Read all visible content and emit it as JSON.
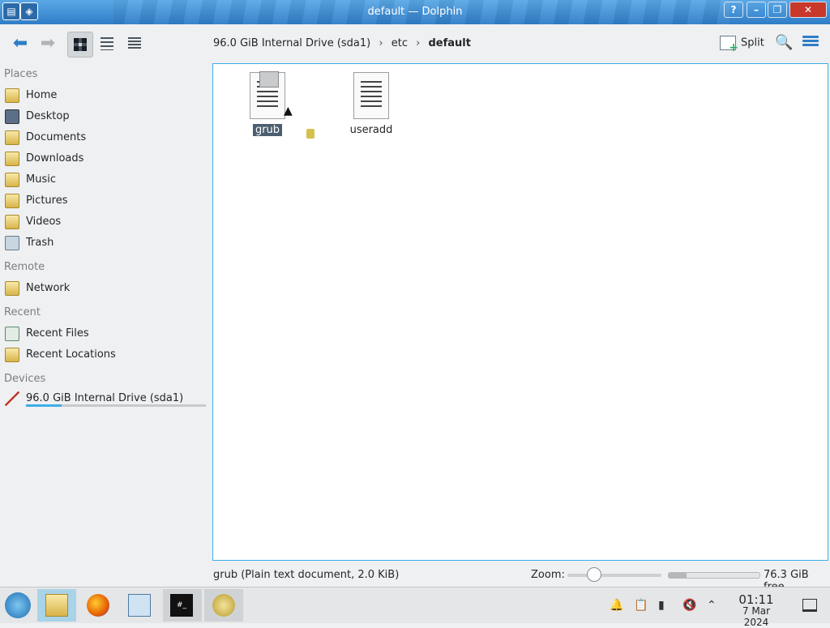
{
  "window": {
    "title": "default — Dolphin"
  },
  "toolbar": {
    "breadcrumb": [
      "96.0 GiB Internal Drive (sda1)",
      "etc",
      "default"
    ],
    "split_label": "Split"
  },
  "sidebar": {
    "sections": [
      {
        "title": "Places",
        "items": [
          {
            "label": "Home",
            "icon": "home-folder-icon"
          },
          {
            "label": "Desktop",
            "icon": "desktop-icon"
          },
          {
            "label": "Documents",
            "icon": "documents-folder-icon"
          },
          {
            "label": "Downloads",
            "icon": "downloads-folder-icon"
          },
          {
            "label": "Music",
            "icon": "music-folder-icon"
          },
          {
            "label": "Pictures",
            "icon": "pictures-folder-icon"
          },
          {
            "label": "Videos",
            "icon": "videos-folder-icon"
          },
          {
            "label": "Trash",
            "icon": "trash-icon"
          }
        ]
      },
      {
        "title": "Remote",
        "items": [
          {
            "label": "Network",
            "icon": "network-folder-icon"
          }
        ]
      },
      {
        "title": "Recent",
        "items": [
          {
            "label": "Recent Files",
            "icon": "recent-files-icon"
          },
          {
            "label": "Recent Locations",
            "icon": "recent-locations-icon"
          }
        ]
      },
      {
        "title": "Devices",
        "items": [
          {
            "label": "96.0 GiB Internal Drive (sda1)",
            "icon": "drive-icon"
          }
        ]
      }
    ],
    "drive_usage_fraction": 0.2
  },
  "files": [
    {
      "name": "grub",
      "selected": true,
      "icon": "text-document-icon"
    },
    {
      "name": "useradd",
      "selected": false,
      "icon": "text-document-icon"
    }
  ],
  "statusbar": {
    "selection": "grub (Plain text document, 2.0 KiB)",
    "zoom_label": "Zoom:",
    "free_space": "76.3 GiB free"
  },
  "taskbar": {
    "time": "01:11",
    "date": "7 Mar 2024",
    "apps": [
      "start-menu-icon",
      "file-manager-icon",
      "firefox-icon",
      "system-settings-icon",
      "terminal-icon",
      "archive-icon"
    ]
  },
  "colors": {
    "accent": "#3daee9",
    "titlebar": "#2f7dc7",
    "selection": "#4b5d6e"
  }
}
